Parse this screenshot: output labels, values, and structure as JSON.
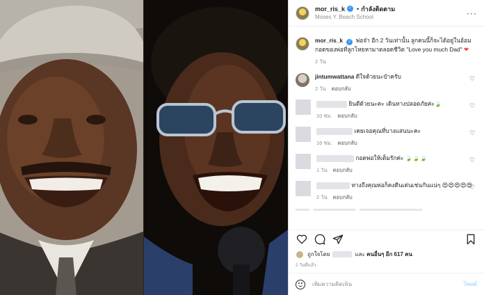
{
  "header": {
    "username": "mor_ris_k",
    "separator": "•",
    "follow_status": "กำลังติดตาม",
    "location": "Moses Y. Beach School",
    "more": "···"
  },
  "caption": {
    "username": "mor_ris_k",
    "text": "พ่อจ๋า อีก 2 วันเท่านั้น ลูกคนนี้ก็จะได้อยู่ในอ้อมกอดของพ่อที่ลูกโหยหามาตลอดชีวิต \"Love you much Dad\"",
    "heart": "❤",
    "time": "2 วัน"
  },
  "comments": [
    {
      "username": "jintumwattana",
      "text": "ดีใจด้วยนะป๋าครับ",
      "time": "2 วัน",
      "reply": "ตอบกลับ"
    },
    {
      "username": "",
      "text": "ยินดีด้วยนะคะ เดินทางปลอดภัยค่ะ🍃",
      "time": "10 ชม.",
      "reply": "ตอบกลับ"
    },
    {
      "username": "",
      "text": "เคยเจอคุณที่บางแสนนะคะ",
      "time": "16 ชม.",
      "reply": "ตอบกลับ"
    },
    {
      "username": "",
      "text": "กอดพ่อให้เต็มรักค่ะ 🍃🍃🍃",
      "time": "1 วัน",
      "reply": "ตอบกลับ"
    },
    {
      "username": "",
      "text": "ทางถึงคุณพ่อก็คงดีนเด่นเช่นกันแน่ๆ 😍😍😍😍😍",
      "time": "2 วัน",
      "reply": "ตอบกลับ"
    }
  ],
  "likes": {
    "prefix": "ถูกใจโดย",
    "connector": "และ",
    "others": "คนอื่นๆ อีก 617 คน"
  },
  "post_time": "2 วันที่แล้ว",
  "add_comment": {
    "placeholder": "เพิ่มความคิดเห็น",
    "post_label": "โพสต์"
  },
  "icons": {
    "like": "heart-outline-icon",
    "comment": "comment-icon",
    "share": "paper-plane-icon",
    "save": "bookmark-icon",
    "emoji": "smiley-icon"
  },
  "colors": {
    "verified": "#3897f0",
    "link_disabled": "#b2dffc",
    "heart": "#ed4956",
    "secondary_text": "#8e8e8e"
  }
}
